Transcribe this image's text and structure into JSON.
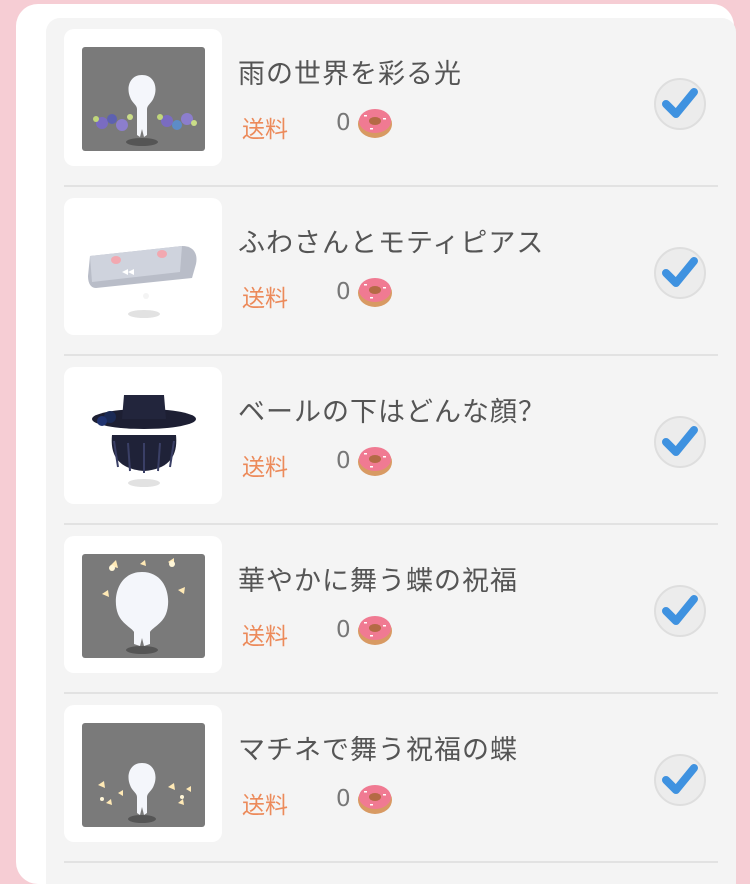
{
  "items": [
    {
      "title": "雨の世界を彩る光",
      "shipping_label": "送料",
      "price": "0",
      "checked": true,
      "thumb_bg": "dark",
      "thumb_icon": "avatar-rain-lights-icon"
    },
    {
      "title": "ふわさんとモティピアス",
      "shipping_label": "送料",
      "price": "0",
      "checked": true,
      "thumb_bg": "light",
      "thumb_icon": "earrings-card-icon"
    },
    {
      "title": "ベールの下はどんな顔？",
      "shipping_label": "送料",
      "price": "0",
      "checked": true,
      "thumb_bg": "light",
      "thumb_icon": "black-hat-veil-icon"
    },
    {
      "title": "華やかに舞う蝶の祝福",
      "shipping_label": "送料",
      "price": "0",
      "checked": true,
      "thumb_bg": "dark",
      "thumb_icon": "avatar-butterflies-icon"
    },
    {
      "title": "マチネで舞う祝福の蝶",
      "shipping_label": "送料",
      "price": "0",
      "checked": true,
      "thumb_bg": "dark",
      "thumb_icon": "avatar-butterflies-low-icon"
    }
  ],
  "colors": {
    "background": "#f6cdd4",
    "shipping_text": "#ec8a5a",
    "check_blue": "#3f92e0",
    "donut_pink": "#f07a92"
  }
}
